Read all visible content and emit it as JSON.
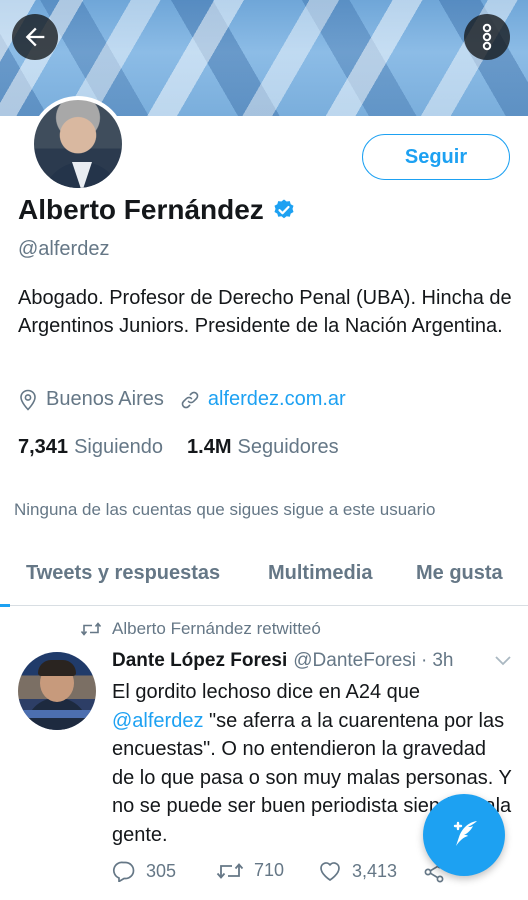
{
  "header": {
    "back_icon": "arrow-left-icon",
    "more_icon": "more-vertical-icon"
  },
  "profile": {
    "follow_label": "Seguir",
    "name": "Alberto Fernández",
    "verified_icon": "verified-badge-icon",
    "handle": "@alferdez",
    "bio": "Abogado. Profesor de Derecho Penal (UBA). Hincha de Argentinos Juniors. Presidente de la Nación Argentina.",
    "location": "Buenos Aires",
    "website": "alferdez.com.ar",
    "following_count": "7,341",
    "following_label": "Siguiendo",
    "followers_count": "1.4M",
    "followers_label": "Seguidores",
    "no_mutual_text": "Ninguna de las cuentas que sigues sigue a este usuario"
  },
  "tabs": [
    {
      "label": "Tweets y respuestas"
    },
    {
      "label": "Multimedia"
    },
    {
      "label": "Me gusta"
    }
  ],
  "tweet": {
    "retweet_context": "Alberto Fernández retwitteó",
    "author_name": "Dante López Foresi",
    "author_handle": "@DanteForesi",
    "separator": "·",
    "time": "3h",
    "text_before_mention": "El gordito lechoso dice en A24 que ",
    "mention": "@alferdez",
    "text_after_mention": " \"se aferra a la cuarentena por las encuestas\". O no entendieron la gravedad de lo que pasa o son muy malas personas. Y no se puede ser buen periodista siendo mala gente.",
    "replies": "305",
    "retweets": "710",
    "likes": "3,413"
  },
  "colors": {
    "accent": "#1da1f2",
    "text_primary": "#14171a",
    "text_secondary": "#657786"
  }
}
